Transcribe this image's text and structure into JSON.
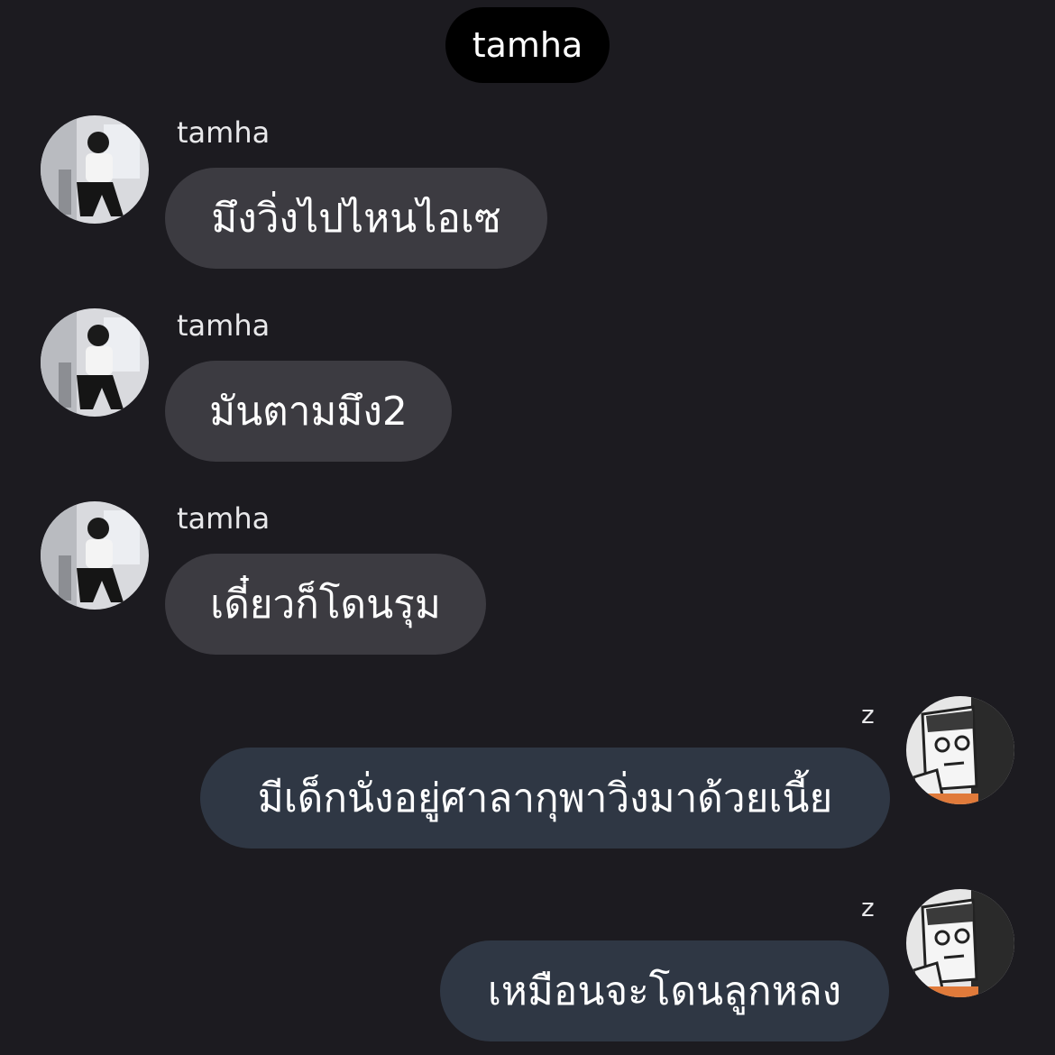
{
  "chat": {
    "title": "tamha"
  },
  "messages": [
    {
      "sender": "tamha",
      "text": "มึงวิ่งไปไหนไอเซ",
      "direction": "incoming",
      "avatar": "avatar-photo-person"
    },
    {
      "sender": "tamha",
      "text": "มันตามมึง2",
      "direction": "incoming",
      "avatar": "avatar-photo-person"
    },
    {
      "sender": "tamha",
      "text": "เดี๋ยวก็โดนรุม",
      "direction": "incoming",
      "avatar": "avatar-photo-person"
    },
    {
      "sender": "z",
      "text": "มีเด็กนั่งอยู่ศาลากุพาวิ่งมาด้วยเนี้ย",
      "direction": "outgoing",
      "avatar": "avatar-meme-face"
    },
    {
      "sender": "z",
      "text": "เหมือนจะโดนลูกหลง",
      "direction": "outgoing",
      "avatar": "avatar-meme-face"
    }
  ],
  "colors": {
    "background": "#1c1b20",
    "incoming_bubble": "#3c3b41",
    "outgoing_bubble": "#2f3744",
    "title_pill": "#000000"
  }
}
